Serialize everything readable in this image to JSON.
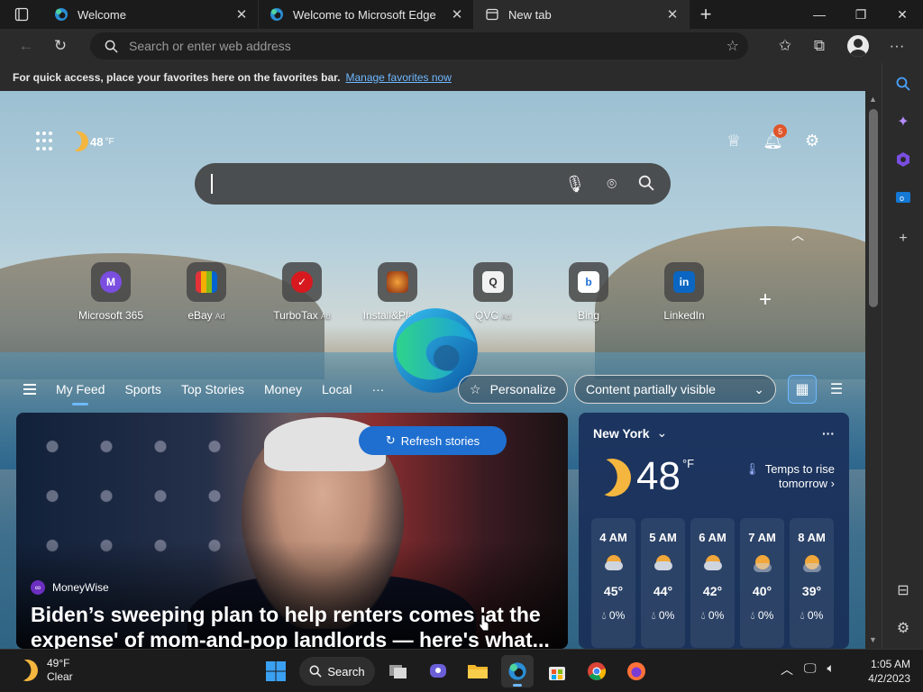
{
  "tabs": [
    {
      "title": "Welcome",
      "active": false
    },
    {
      "title": "Welcome to Microsoft Edge",
      "active": false
    },
    {
      "title": "New tab",
      "active": true
    }
  ],
  "address_bar": {
    "placeholder": "Search or enter web address"
  },
  "favorites_bar": {
    "message": "For quick access, place your favorites here on the favorites bar.",
    "link": "Manage favorites now"
  },
  "ntp": {
    "header_weather_temp": "48",
    "header_weather_unit": "°F",
    "notification_count": "5",
    "quick_links": [
      {
        "label": "Microsoft 365",
        "ad": "",
        "color": "#7a4ee0",
        "glyph": "M"
      },
      {
        "label": "eBay",
        "ad": "Ad",
        "color": "#2d6ad6",
        "glyph": "e"
      },
      {
        "label": "TurboTax",
        "ad": "Ad",
        "color": "#d7191f",
        "glyph": "✓"
      },
      {
        "label": "Install&Play",
        "ad": "Ad",
        "color": "#b34a12",
        "glyph": "▲"
      },
      {
        "label": "QVC",
        "ad": "Ad",
        "color": "#f2f2f2",
        "glyph": "Q"
      },
      {
        "label": "Bing",
        "ad": "",
        "color": "#ffffff",
        "glyph": "b"
      },
      {
        "label": "LinkedIn",
        "ad": "",
        "color": "#0a66c2",
        "glyph": "in"
      }
    ],
    "feed_tabs": [
      "My Feed",
      "Sports",
      "Top Stories",
      "Money",
      "Local"
    ],
    "feed_more": "···",
    "personalize_label": "Personalize",
    "content_visibility_label": "Content partially visible",
    "refresh_label": "Refresh stories",
    "hero": {
      "source": "MoneyWise",
      "headline": "Biden’s sweeping plan to help renters comes 'at the expense' of mom-and-pop landlords — here's what..."
    },
    "weather": {
      "location": "New York",
      "temp": "48",
      "unit": "°F",
      "note_line1": "Temps to rise",
      "note_line2": "tomorrow",
      "hourly": [
        {
          "time": "4 AM",
          "temp": "45°",
          "precip": "0%"
        },
        {
          "time": "5 AM",
          "temp": "44°",
          "precip": "0%"
        },
        {
          "time": "6 AM",
          "temp": "42°",
          "precip": "0%"
        },
        {
          "time": "7 AM",
          "temp": "40°",
          "precip": "0%"
        },
        {
          "time": "8 AM",
          "temp": "39°",
          "precip": "0%"
        }
      ]
    }
  },
  "taskbar": {
    "weather_temp": "49°F",
    "weather_desc": "Clear",
    "search_label": "Search",
    "time": "1:05 AM",
    "date": "4/2/2023"
  },
  "colors": {
    "accent": "#6fb8ff",
    "refresh": "#1f6fd0",
    "badge": "#e0552a"
  }
}
